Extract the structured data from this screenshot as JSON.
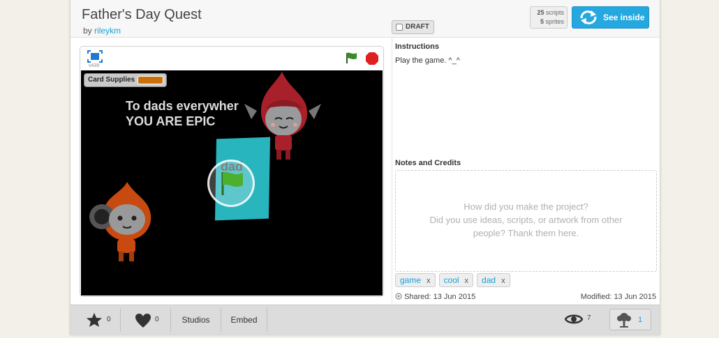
{
  "project": {
    "title": "Father's Day Quest",
    "by_prefix": "by",
    "author": "rileykm",
    "draft_label": "DRAFT"
  },
  "stats": {
    "scripts_count": "25",
    "scripts_label": "scripts",
    "sprites_count": "5",
    "sprites_label": "sprites"
  },
  "see_inside_label": "See inside",
  "player": {
    "version": "v439",
    "monitor_label": "Card Supplies",
    "stage_line1": "To dads everywher",
    "stage_line2": "YOU ARE EPIC",
    "card_text": "dad"
  },
  "instructions": {
    "heading": "Instructions",
    "text": "Play the game. ^_^"
  },
  "notes": {
    "heading": "Notes and Credits",
    "placeholder_line1": "How did you make the project?",
    "placeholder_line2": "Did you use ideas, scripts, or artwork from other",
    "placeholder_line3": "people? Thank them here."
  },
  "tags": [
    {
      "label": "game",
      "remove": "x"
    },
    {
      "label": "cool",
      "remove": "x"
    },
    {
      "label": "dad",
      "remove": "x"
    }
  ],
  "dates": {
    "shared": "Shared: 13 Jun 2015",
    "modified": "Modified: 13 Jun 2015"
  },
  "footer": {
    "favorites": "0",
    "loves": "0",
    "studios_label": "Studios",
    "embed_label": "Embed",
    "views": "7",
    "remixes": "1"
  },
  "colors": {
    "accent": "#25a8e0",
    "stage_background": "#000000",
    "card": "#29b5be",
    "monitor_value": "#c8700a",
    "stop": "#e02020",
    "flag": "#3a8a2a"
  },
  "icons": {
    "fullscreen": "fullscreen-icon",
    "green_flag": "green-flag-icon",
    "stop": "stop-icon",
    "see_inside": "remix-arrows-icon",
    "star": "star-icon",
    "heart": "heart-icon",
    "views": "eye-icon",
    "remix": "remix-tree-icon",
    "shared": "share-icon"
  }
}
